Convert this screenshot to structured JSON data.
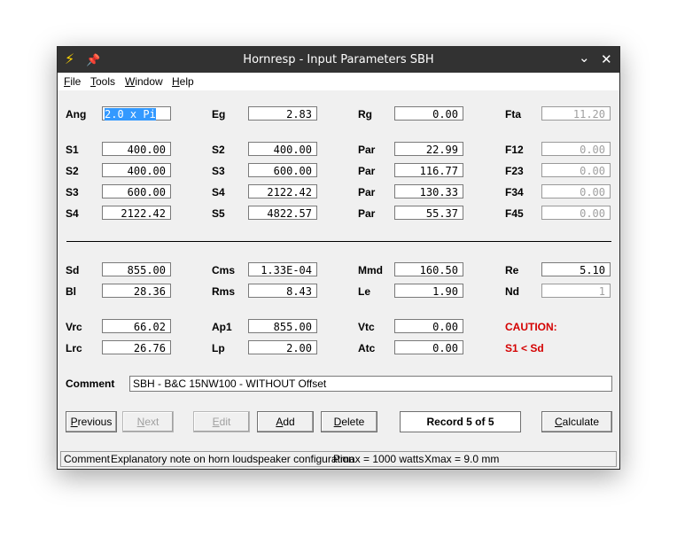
{
  "window": {
    "title": "Hornresp - Input Parameters SBH"
  },
  "menu": [
    {
      "label": "File",
      "key": "F",
      "rest": "ile"
    },
    {
      "label": "Tools",
      "key": "T",
      "rest": "ools"
    },
    {
      "label": "Window",
      "key": "W",
      "rest": "indow"
    },
    {
      "label": "Help",
      "key": "H",
      "rest": "elp"
    }
  ],
  "params": {
    "row0": [
      {
        "label": "Ang",
        "value": "2.0 x Pi"
      },
      {
        "label": "Eg",
        "value": "2.83"
      },
      {
        "label": "Rg",
        "value": "0.00"
      },
      {
        "label": "Fta",
        "value": "11.20"
      }
    ],
    "rows": [
      [
        {
          "label": "S1",
          "value": "400.00"
        },
        {
          "label": "S2",
          "value": "400.00"
        },
        {
          "label": "Par",
          "value": "22.99"
        },
        {
          "label": "F12",
          "value": "0.00"
        }
      ],
      [
        {
          "label": "S2",
          "value": "400.00"
        },
        {
          "label": "S3",
          "value": "600.00"
        },
        {
          "label": "Par",
          "value": "116.77"
        },
        {
          "label": "F23",
          "value": "0.00"
        }
      ],
      [
        {
          "label": "S3",
          "value": "600.00"
        },
        {
          "label": "S4",
          "value": "2122.42"
        },
        {
          "label": "Par",
          "value": "130.33"
        },
        {
          "label": "F34",
          "value": "0.00"
        }
      ],
      [
        {
          "label": "S4",
          "value": "2122.42"
        },
        {
          "label": "S5",
          "value": "4822.57"
        },
        {
          "label": "Par",
          "value": "55.37"
        },
        {
          "label": "F45",
          "value": "0.00"
        }
      ]
    ],
    "driver": [
      [
        {
          "label": "Sd",
          "value": "855.00"
        },
        {
          "label": "Cms",
          "value": "1.33E-04"
        },
        {
          "label": "Mmd",
          "value": "160.50"
        },
        {
          "label": "Re",
          "value": "5.10"
        }
      ],
      [
        {
          "label": "Bl",
          "value": "28.36"
        },
        {
          "label": "Rms",
          "value": "8.43"
        },
        {
          "label": "Le",
          "value": "1.90"
        },
        {
          "label": "Nd",
          "value": "1"
        }
      ]
    ],
    "chamber": [
      [
        {
          "label": "Vrc",
          "value": "66.02"
        },
        {
          "label": "Ap1",
          "value": "855.00"
        },
        {
          "label": "Vtc",
          "value": "0.00"
        }
      ],
      [
        {
          "label": "Lrc",
          "value": "26.76"
        },
        {
          "label": "Lp",
          "value": "2.00"
        },
        {
          "label": "Atc",
          "value": "0.00"
        }
      ]
    ],
    "caution_title": "CAUTION:",
    "caution_text": "S1 < Sd"
  },
  "comment": {
    "label": "Comment",
    "value": "SBH - B&C 15NW100 - WITHOUT Offset"
  },
  "buttons": {
    "previous": {
      "label": "Previous",
      "key": "P",
      "rest": "revious"
    },
    "next": {
      "label": "Next",
      "key": "N",
      "rest": "ext"
    },
    "edit": {
      "label": "Edit",
      "key": "E",
      "rest": "dit"
    },
    "add": {
      "label": "Add",
      "key": "A",
      "rest": "dd"
    },
    "delete": {
      "label": "Delete",
      "key": "D",
      "rest": "elete"
    },
    "calculate": {
      "label": "Calculate",
      "key": "C",
      "rest": "alculate"
    }
  },
  "record": "Record 5 of 5",
  "status": {
    "field": "Comment",
    "note": "Explanatory note on horn loudspeaker configuration",
    "pmax": "Pmax = 1000 watts",
    "xmax": "Xmax = 9.0 mm"
  },
  "colors": {
    "titlebar": "#323232",
    "selection": "#3399ff",
    "caution": "#d40000"
  }
}
